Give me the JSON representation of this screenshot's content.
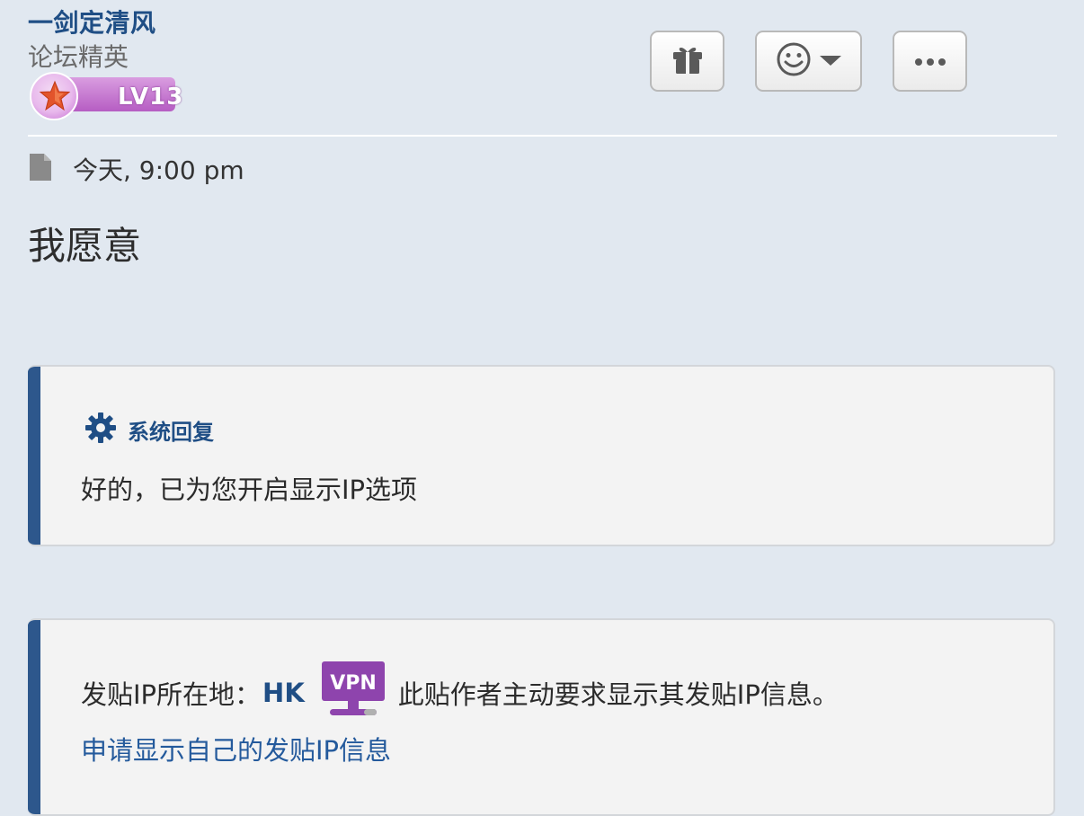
{
  "author": {
    "name": "一剑定清风",
    "rank": "论坛精英",
    "level": "LV13"
  },
  "actions": {
    "gift_icon": "gift-icon",
    "emoji_icon": "smiley-icon",
    "more_icon": "ellipsis-icon"
  },
  "post": {
    "timestamp": "今天, 9:00 pm",
    "body": "我愿意"
  },
  "system_reply": {
    "title": "系统回复",
    "message": "好的，已为您开启显示IP选项"
  },
  "ip_info": {
    "label": "发贴IP所在地：",
    "code": "HK",
    "vpn_label": "VPN",
    "note": "此贴作者主动要求显示其发贴IP信息。",
    "link": "申请显示自己的发贴IP信息"
  },
  "colors": {
    "background": "#e1e8f0",
    "accent": "#1f4e85",
    "card_bar": "#2d578c",
    "vpn": "#8e44ad"
  }
}
